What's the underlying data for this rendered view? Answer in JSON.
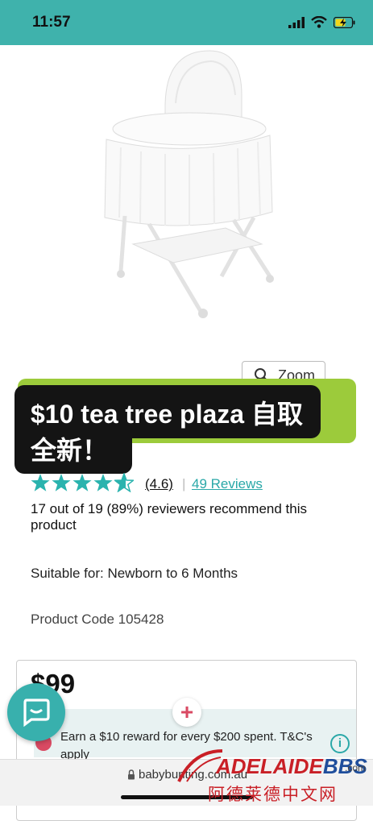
{
  "status_bar": {
    "time": "11:57",
    "icons": [
      "signal-icon",
      "wifi-icon",
      "battery-charging-icon"
    ]
  },
  "colors": {
    "brand_teal": "#3fb2ac",
    "accent_green": "#9ccb3b",
    "link": "#2aa8a8",
    "star": "#2ab3ae",
    "reward_pink": "#d94a63"
  },
  "zoom": {
    "label": "Zoom"
  },
  "caption": {
    "line1": "$10 tea tree plaza 自取",
    "line2": "全新！"
  },
  "rating": {
    "stars": 4.6,
    "value_label": "(4.6)",
    "separator": "|",
    "reviews_label": "49 Reviews"
  },
  "recommend": {
    "text": "17 out of 19 (89%) reviewers recommend this product"
  },
  "suitable": {
    "text": "Suitable for: Newborn to 6 Months"
  },
  "product_code": {
    "text": "Product Code 105428"
  },
  "price": {
    "value": "$99"
  },
  "reward": {
    "plus": "+",
    "text": "Earn a $10 reward for every $200 spent. T&C's apply",
    "info": "i"
  },
  "browser": {
    "url": "babybunting.com.au"
  },
  "watermark": {
    "line1_a": "ADELAIDE",
    "line1_b": "BBS",
    "com": ".com",
    "line2": "阿德莱德中文网"
  }
}
